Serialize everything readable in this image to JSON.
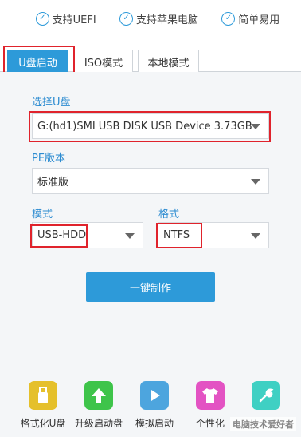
{
  "features": [
    {
      "label": "支持UEFI",
      "icon": "check-circle-icon"
    },
    {
      "label": "支持苹果电脑",
      "icon": "check-circle-icon"
    },
    {
      "label": "简单易用",
      "icon": "check-circle-icon"
    }
  ],
  "tabs": [
    {
      "label": "U盘启动",
      "active": true
    },
    {
      "label": "ISO模式",
      "active": false
    },
    {
      "label": "本地模式",
      "active": false
    }
  ],
  "form": {
    "usb_label": "选择U盘",
    "usb_value": "G:(hd1)SMI USB DISK USB Device 3.73GB",
    "pe_label": "PE版本",
    "pe_value": "标准版",
    "mode_label": "模式",
    "mode_value": "USB-HDD",
    "format_label": "格式",
    "format_value": "NTFS"
  },
  "make_button": "一键制作",
  "tools": [
    {
      "label": "格式化U盘",
      "icon": "usb-drive-icon",
      "color": "#e5c02b"
    },
    {
      "label": "升级启动盘",
      "icon": "upgrade-arrow-icon",
      "color": "#3ec44a"
    },
    {
      "label": "模拟启动",
      "icon": "play-icon",
      "color": "#4da5de"
    },
    {
      "label": "个性化",
      "icon": "tshirt-icon",
      "color": "#e353c3"
    },
    {
      "label": "",
      "icon": "wrench-icon",
      "color": "#3fd0c3"
    }
  ],
  "watermark": "电脑技术爱好者",
  "colors": {
    "accent": "#2d9ad9",
    "highlight_frame": "#e0232c",
    "panel_bg": "#f4f6f8"
  }
}
